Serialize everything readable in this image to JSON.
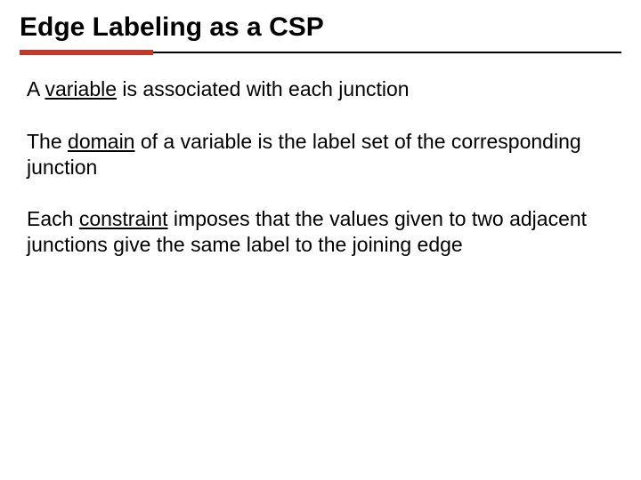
{
  "title": "Edge Labeling as a CSP",
  "paragraphs": {
    "p1": {
      "pre": "A ",
      "kw": "variable",
      "post": " is associated with each junction"
    },
    "p2": {
      "pre": "The ",
      "kw": "domain",
      "post": " of a variable is the label set of the corresponding junction"
    },
    "p3": {
      "pre": "Each ",
      "kw": "constraint",
      "post": " imposes that the values given to two adjacent junctions give the same label to the joining edge"
    }
  }
}
